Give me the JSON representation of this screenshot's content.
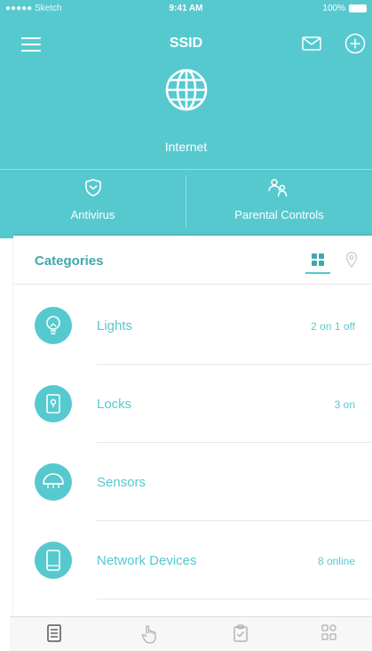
{
  "status_bar": {
    "carrier": "●●●●● Sketch",
    "time": "9:41 AM",
    "battery": "100%"
  },
  "nav": {
    "title": "SSID",
    "menu_icon": "hamburger-menu-icon",
    "mail_icon": "envelope-icon",
    "add_icon": "plus-circle-icon"
  },
  "internet": {
    "label": "Internet",
    "icon": "globe-icon"
  },
  "quick_actions": [
    {
      "label": "Antivirus",
      "icon": "shield-icon"
    },
    {
      "label": "Parental Controls",
      "icon": "parent-child-icon"
    }
  ],
  "categories": {
    "title": "Categories",
    "view_icons": [
      "grid-view-icon",
      "map-pin-icon"
    ],
    "items": [
      {
        "label": "Lights",
        "status": "2 on 1 off",
        "icon": "lightbulb-icon"
      },
      {
        "label": "Locks",
        "status": "3 on",
        "icon": "lock-icon"
      },
      {
        "label": "Sensors",
        "status": "",
        "icon": "sensor-icon"
      },
      {
        "label": "Network Devices",
        "status": "8 online",
        "icon": "tablet-icon"
      }
    ]
  },
  "tab_bar": {
    "tabs": [
      "document-list-icon",
      "hand-touch-icon",
      "clipboard-check-icon",
      "apps-grid-icon"
    ]
  },
  "colors": {
    "accent": "#56c9cf",
    "text_accent": "#3fa8ad",
    "divider": "#e4e9ea"
  }
}
